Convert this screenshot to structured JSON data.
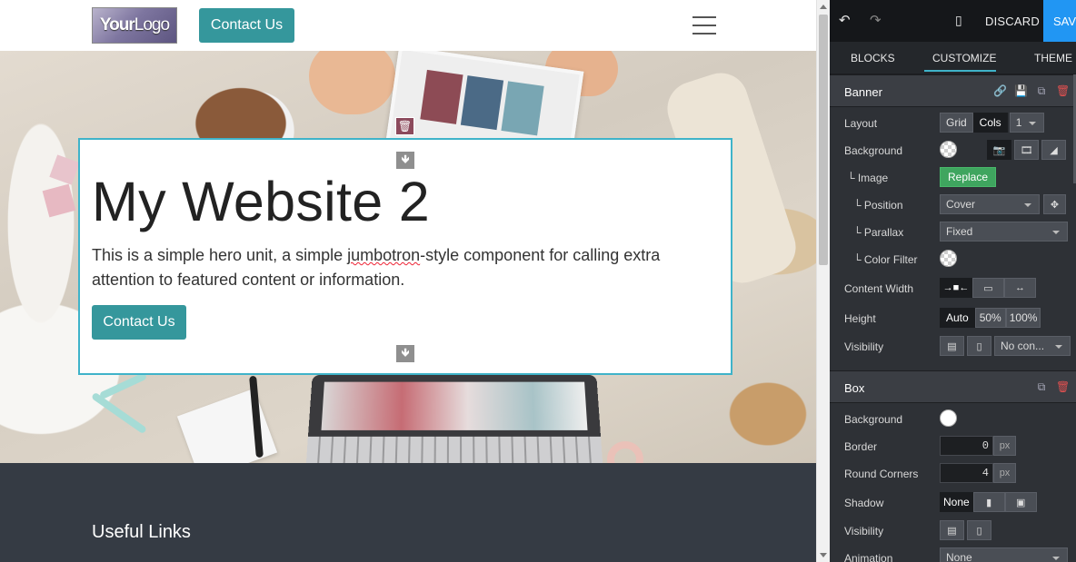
{
  "site": {
    "logo_text_bold": "Your",
    "logo_text_thin": "Logo",
    "header_button": "Contact Us",
    "hero": {
      "title": "My Website 2",
      "text_before": "This is a simple hero unit, a simple ",
      "text_misspelled": "jumbotron",
      "text_after": "-style component for calling extra attention to featured content or information.",
      "button": "Contact Us"
    },
    "footer": {
      "heading": "Useful Links"
    }
  },
  "editor": {
    "topbar": {
      "undo_icon": "undo-icon",
      "redo_icon": "redo-icon",
      "mobile_icon": "mobile-preview-icon",
      "discard": "DISCARD",
      "save": "SAVE"
    },
    "tabs": [
      "BLOCKS",
      "CUSTOMIZE",
      "THEME"
    ],
    "active_tab": "CUSTOMIZE",
    "banner": {
      "title": "Banner",
      "layout_label": "Layout",
      "layout_options": [
        "Grid",
        "Cols"
      ],
      "layout_active": "Cols",
      "cols_value": "1",
      "background_label": "Background",
      "image_label": "└ Image",
      "replace_button": "Replace",
      "position_label": "└ Position",
      "position_value": "Cover",
      "parallax_label": "└ Parallax",
      "parallax_value": "Fixed",
      "color_filter_label": "└ Color Filter",
      "content_width_label": "Content Width",
      "height_label": "Height",
      "height_options": [
        "Auto",
        "50%",
        "100%"
      ],
      "height_active": "Auto",
      "visibility_label": "Visibility",
      "visibility_value": "No con..."
    },
    "box": {
      "title": "Box",
      "background_label": "Background",
      "border_label": "Border",
      "border_value": "0",
      "border_unit": "px",
      "radius_label": "Round Corners",
      "radius_value": "4",
      "radius_unit": "px",
      "shadow_label": "Shadow",
      "shadow_value": "None",
      "visibility_label": "Visibility",
      "animation_label": "Animation",
      "animation_value": "None"
    }
  },
  "colors": {
    "accent_teal": "#35979c",
    "selection_border": "#3fb3c9",
    "save_blue": "#2196f3",
    "replace_green": "#3fa55f",
    "panel_bg": "#2e3136",
    "footer_bg": "#353b44"
  }
}
